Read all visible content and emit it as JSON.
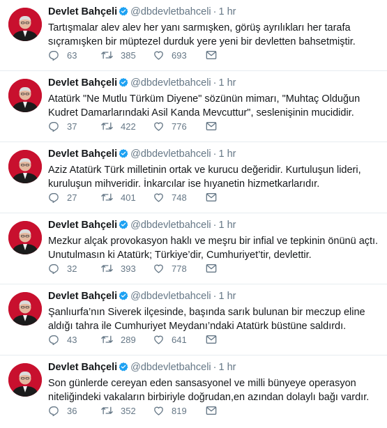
{
  "tweets": [
    {
      "name": "Devlet Bahçeli",
      "handle": "@dbdevletbahceli",
      "separator": "·",
      "time": "1 hr",
      "text": "Tartışmalar alev alev her yanı sarmışken, görüş ayrılıkları her tarafa sıçramışken bir müptezel durduk yere yeni bir devletten bahsetmiştir.",
      "replies": "63",
      "retweets": "385",
      "likes": "693"
    },
    {
      "name": "Devlet Bahçeli",
      "handle": "@dbdevletbahceli",
      "separator": "·",
      "time": "1 hr",
      "text": "Atatürk \"Ne Mutlu Türküm Diyene\" sözünün mimarı, \"Muhtaç Olduğun Kudret Damarlarındaki Asil Kanda Mevcuttur\", seslenişinin mucididir.",
      "replies": "37",
      "retweets": "422",
      "likes": "776"
    },
    {
      "name": "Devlet Bahçeli",
      "handle": "@dbdevletbahceli",
      "separator": "·",
      "time": "1 hr",
      "text": "Aziz Atatürk Türk milletinin ortak ve kurucu değeridir. Kurtuluşun lideri, kuruluşun mihveridir. İnkarcılar ise hıyanetin hizmetkarlarıdır.",
      "replies": "27",
      "retweets": "401",
      "likes": "748"
    },
    {
      "name": "Devlet Bahçeli",
      "handle": "@dbdevletbahceli",
      "separator": "·",
      "time": "1 hr",
      "text": "Mezkur alçak provokasyon haklı ve meşru bir infial ve tepkinin önünü açtı. Unutulmasın ki Atatürk; Türkiye’dir, Cumhuriyet’tir, devlettir.",
      "replies": "32",
      "retweets": "393",
      "likes": "778"
    },
    {
      "name": "Devlet Bahçeli",
      "handle": "@dbdevletbahceli",
      "separator": "·",
      "time": "1 hr",
      "text": "Şanlıurfa’nın Siverek ilçesinde, başında sarık bulunan bir meczup eline aldığı tahra ile Cumhuriyet Meydanı’ndaki Atatürk büstüne saldırdı.",
      "replies": "43",
      "retweets": "289",
      "likes": "641"
    },
    {
      "name": "Devlet Bahçeli",
      "handle": "@dbdevletbahceli",
      "separator": "·",
      "time": "1 hr",
      "text": "Son günlerde cereyan eden sansasyonel ve milli bünyeye operasyon niteliğindeki vakaların birbiriyle doğrudan,en azından dolaylı bağı vardır.",
      "replies": "36",
      "retweets": "352",
      "likes": "819"
    }
  ],
  "colors": {
    "text": "#14171a",
    "muted": "#657786",
    "verified": "#1da1f2",
    "divider": "#e6ecf0",
    "avatar_bg": "#c8102e"
  },
  "icons": {
    "reply": "reply-icon",
    "retweet": "retweet-icon",
    "like": "heart-icon",
    "dm": "envelope-icon",
    "verified": "verified-badge-icon"
  }
}
